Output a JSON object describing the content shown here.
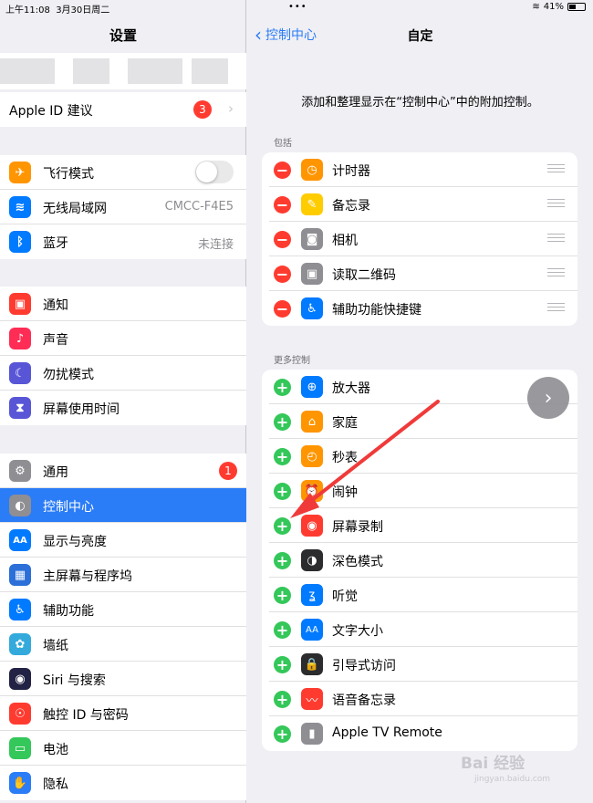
{
  "status": {
    "time": "上午11:08",
    "date": "3月30日周二",
    "battery": "41%"
  },
  "left": {
    "title": "设置",
    "apple_id": {
      "label": "Apple ID 建议",
      "badge": "3"
    },
    "group1": [
      {
        "label": "飞行模式",
        "icon": "airplane-icon",
        "color": "#ff9500",
        "glyph": "✈"
      },
      {
        "label": "无线局域网",
        "icon": "wifi-icon",
        "color": "#007aff",
        "glyph": "≋",
        "value": "CMCC-F4E5"
      },
      {
        "label": "蓝牙",
        "icon": "bluetooth-icon",
        "color": "#007aff",
        "glyph": "ᛒ",
        "value": "未连接"
      }
    ],
    "group2": [
      {
        "label": "通知",
        "icon": "notification-icon",
        "color": "#ff3b30",
        "glyph": "▣"
      },
      {
        "label": "声音",
        "icon": "sound-icon",
        "color": "#ff2d55",
        "glyph": "♪"
      },
      {
        "label": "勿扰模式",
        "icon": "moon-icon",
        "color": "#5856d6",
        "glyph": "☾"
      },
      {
        "label": "屏幕使用时间",
        "icon": "hourglass-icon",
        "color": "#5856d6",
        "glyph": "⧗"
      }
    ],
    "group3": [
      {
        "label": "通用",
        "icon": "gear-icon",
        "color": "#8e8e93",
        "glyph": "⚙",
        "badge": "1"
      },
      {
        "label": "控制中心",
        "icon": "toggles-icon",
        "color": "#8e8e93",
        "glyph": "◐"
      },
      {
        "label": "显示与亮度",
        "icon": "display-icon",
        "color": "#007aff",
        "glyph": "AA"
      },
      {
        "label": "主屏幕与程序坞",
        "icon": "home-grid-icon",
        "color": "#2c6fd8",
        "glyph": "▦"
      },
      {
        "label": "辅助功能",
        "icon": "accessibility-icon",
        "color": "#007aff",
        "glyph": "♿"
      },
      {
        "label": "墙纸",
        "icon": "wallpaper-icon",
        "color": "#34aadc",
        "glyph": "✿"
      },
      {
        "label": "Siri 与搜索",
        "icon": "siri-icon",
        "color": "#222244",
        "glyph": "◉"
      },
      {
        "label": "触控 ID 与密码",
        "icon": "fingerprint-icon",
        "color": "#ff3b30",
        "glyph": "☉"
      },
      {
        "label": "电池",
        "icon": "battery-icon",
        "color": "#34c759",
        "glyph": "▭"
      },
      {
        "label": "隐私",
        "icon": "hand-icon",
        "color": "#2b7cf7",
        "glyph": "✋"
      }
    ]
  },
  "right": {
    "back_label": "控制中心",
    "title": "自定",
    "description": "添加和整理显示在“控制中心”中的附加控制。",
    "included_header": "包括",
    "included": [
      {
        "label": "计时器",
        "icon": "timer-icon",
        "color": "#ff9500",
        "glyph": "◷"
      },
      {
        "label": "备忘录",
        "icon": "notes-icon",
        "color": "#ffcc00",
        "glyph": "✎"
      },
      {
        "label": "相机",
        "icon": "camera-icon",
        "color": "#8e8e93",
        "glyph": "◙"
      },
      {
        "label": "读取二维码",
        "icon": "qr-icon",
        "color": "#8e8e93",
        "glyph": "▣"
      },
      {
        "label": "辅助功能快捷键",
        "icon": "accessibility-icon",
        "color": "#007aff",
        "glyph": "♿"
      }
    ],
    "more_header": "更多控制",
    "more": [
      {
        "label": "放大器",
        "icon": "magnifier-icon",
        "color": "#007aff",
        "glyph": "⊕"
      },
      {
        "label": "家庭",
        "icon": "home-icon",
        "color": "#ff9500",
        "glyph": "⌂"
      },
      {
        "label": "秒表",
        "icon": "stopwatch-icon",
        "color": "#ff9500",
        "glyph": "◴"
      },
      {
        "label": "闹钟",
        "icon": "alarm-icon",
        "color": "#ff9500",
        "glyph": "⏰"
      },
      {
        "label": "屏幕录制",
        "icon": "record-icon",
        "color": "#ff3b30",
        "glyph": "◉"
      },
      {
        "label": "深色模式",
        "icon": "dark-mode-icon",
        "color": "#2c2c2e",
        "glyph": "◑"
      },
      {
        "label": "听觉",
        "icon": "ear-icon",
        "color": "#007aff",
        "glyph": "ʓ"
      },
      {
        "label": "文字大小",
        "icon": "text-size-icon",
        "color": "#007aff",
        "glyph": "AA"
      },
      {
        "label": "引导式访问",
        "icon": "lock-icon",
        "color": "#2c2c2e",
        "glyph": "🔒"
      },
      {
        "label": "语音备忘录",
        "icon": "voice-memo-icon",
        "color": "#ff3b30",
        "glyph": "〰"
      },
      {
        "label": "Apple TV Remote",
        "icon": "remote-icon",
        "color": "#8e8e93",
        "glyph": "▮"
      }
    ]
  },
  "watermark": {
    "text": "Bai 经验",
    "sub": "jingyan.baidu.com"
  }
}
